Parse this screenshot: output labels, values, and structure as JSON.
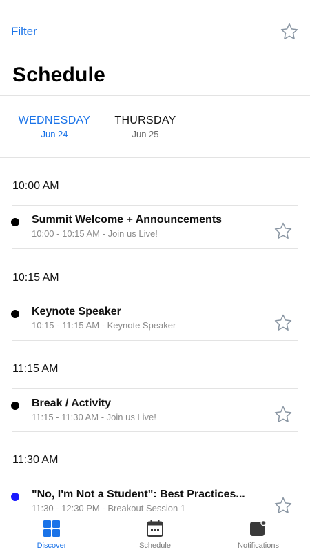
{
  "header": {
    "filter_label": "Filter",
    "favorite_icon": "star-outline-icon",
    "title": "Schedule"
  },
  "days": [
    {
      "name": "WEDNESDAY",
      "date": "Jun 24",
      "selected": true
    },
    {
      "name": "THURSDAY",
      "date": "Jun 25",
      "selected": false
    }
  ],
  "groups": [
    {
      "time": "10:00 AM",
      "session": {
        "title": "Summit Welcome + Announcements",
        "subtitle": "10:00 - 10:15 AM - Join us Live!",
        "dot_color": "#000000"
      }
    },
    {
      "time": "10:15 AM",
      "session": {
        "title": "Keynote Speaker",
        "subtitle": "10:15 - 11:15 AM - Keynote Speaker",
        "dot_color": "#000000"
      }
    },
    {
      "time": "11:15 AM",
      "session": {
        "title": "Break / Activity",
        "subtitle": "11:15 - 11:30 AM - Join us Live!",
        "dot_color": "#000000"
      }
    },
    {
      "time": "11:30 AM",
      "session": {
        "title": "\"No, I'm Not a Student\": Best Practices...",
        "subtitle": "11:30 - 12:30 PM - Breakout Session 1",
        "dot_color": "#1a1aff"
      }
    }
  ],
  "tabbar": [
    {
      "label": "Discover",
      "icon": "grid-icon",
      "active": true
    },
    {
      "label": "Schedule",
      "icon": "calendar-icon",
      "active": false
    },
    {
      "label": "Notifications",
      "icon": "notification-badge-icon",
      "active": false
    }
  ],
  "colors": {
    "accent": "#1a73e8",
    "divider": "#e3e3e3",
    "secondary_text": "#8a8a8a",
    "star_stroke": "#8a96a3"
  }
}
